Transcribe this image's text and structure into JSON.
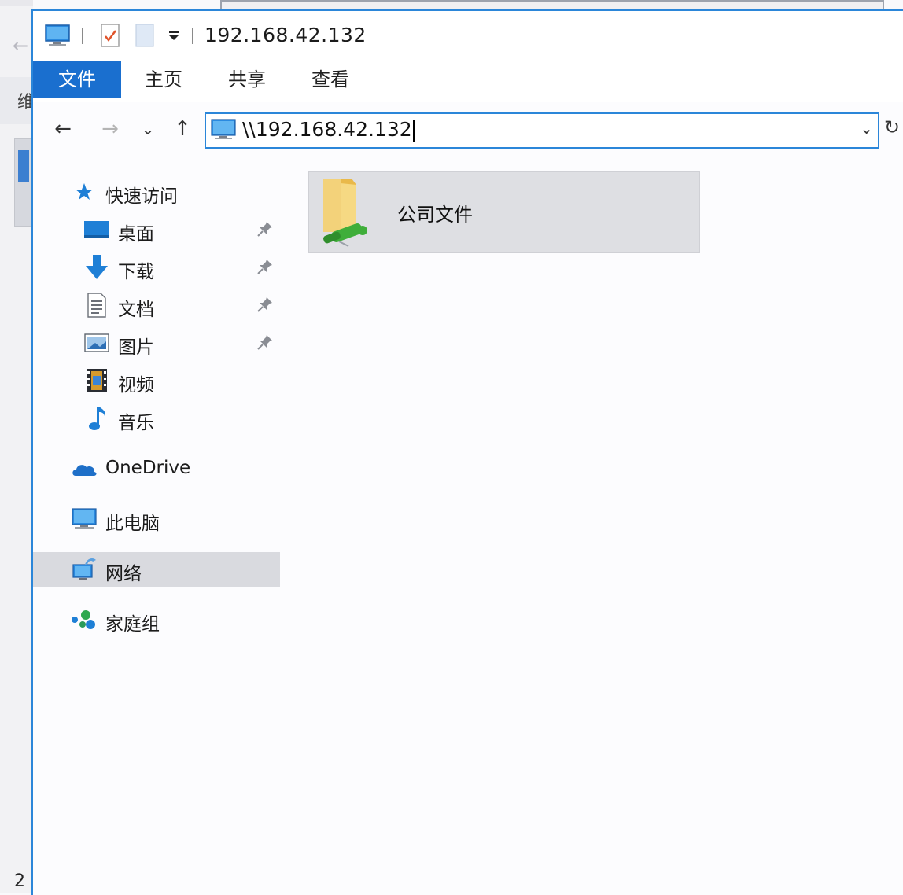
{
  "background_window": {
    "fragment_char": "维",
    "item_count": "2"
  },
  "titlebar": {
    "title": "192.168.42.132",
    "quick_access_icons": [
      "computer-icon",
      "properties-check-icon",
      "new-folder-icon",
      "customize-dropdown-icon"
    ]
  },
  "ribbon": {
    "tabs": [
      {
        "label": "文件",
        "active": true
      },
      {
        "label": "主页",
        "active": false
      },
      {
        "label": "共享",
        "active": false
      },
      {
        "label": "查看",
        "active": false
      }
    ]
  },
  "navbar": {
    "back": "←",
    "forward": "→",
    "recent": "⌄",
    "up": "↑",
    "address_value": "\\\\192.168.42.132",
    "dropdown": "⌄",
    "refresh": "↻"
  },
  "navpane": {
    "quick_access": "快速访问",
    "items": [
      {
        "label": "桌面",
        "icon": "desktop-icon",
        "pinned": true
      },
      {
        "label": "下载",
        "icon": "download-icon",
        "pinned": true
      },
      {
        "label": "文档",
        "icon": "documents-icon",
        "pinned": true
      },
      {
        "label": "图片",
        "icon": "pictures-icon",
        "pinned": true
      },
      {
        "label": "视频",
        "icon": "videos-icon",
        "pinned": false
      },
      {
        "label": "音乐",
        "icon": "music-icon",
        "pinned": false
      }
    ],
    "onedrive": "OneDrive",
    "this_pc": "此电脑",
    "network": "网络",
    "homegroup": "家庭组",
    "selected": "网络"
  },
  "content": {
    "items": [
      {
        "label": "公司文件",
        "icon": "shared-folder-icon"
      }
    ]
  },
  "colors": {
    "accent": "#1a6fcf",
    "border_blue": "#2b86d9",
    "selection": "#d9dadf"
  }
}
